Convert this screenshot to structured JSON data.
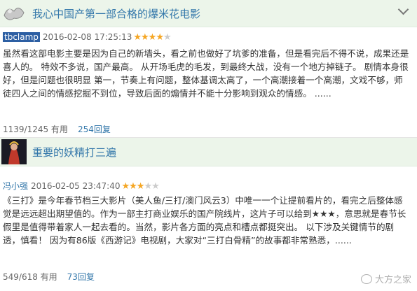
{
  "reviews": [
    {
      "title": "我心中国产第一部合格的爆米花电影",
      "author": "tbclamp",
      "date": "2016-02-08 17:25:13",
      "rating": 4,
      "body": "虽然看这部电影主要是因为自己的新墙头，看之前也做好了坑爹的准备，但是看完后不得不说，成果还是喜人的。 特效不多说，国产最高。 从开场毛虎的毛发，到最终大战，没有一个地方掉链子。 剧情本身很好，但是问题也很明显 第一，节奏上有问题，整体基调太高了，一个高潮接着一个高潮，文戏不够，师徒四人之间的情感挖掘不到位，导致后面的煽情并不能十分影响到观众的情感。 ......",
      "useful": "1139/1245 有用",
      "replies": "254回复"
    },
    {
      "title": "重要的妖精打三遍",
      "author": "冯小强",
      "date": "2016-02-05 23:47:40",
      "rating": 3,
      "body": "《三打》是今年春节档三大影片（美人鱼/三打/澳门风云3）中唯一一个让提前看片的，看完之后整体感觉是远远超出期望值的。作为一部主打商业娱乐的国产院线片，这片子可以给到★★★，意思就是春节长假里是值得带着家人一起去看的。当然，影片各方面的亮点和槽点都挺突出。 以下涉及关键情节的剧透，慎看！ 因为有86版《西游记》电视剧，大家对“三打白骨精”的故事都非常熟悉，......",
      "useful": "549/618 有用",
      "replies": "73回复"
    }
  ],
  "watermark": "大方之家",
  "colors": {
    "header_bg": "#ecf5ea",
    "link": "#3377aa",
    "star": "#f5a623"
  }
}
